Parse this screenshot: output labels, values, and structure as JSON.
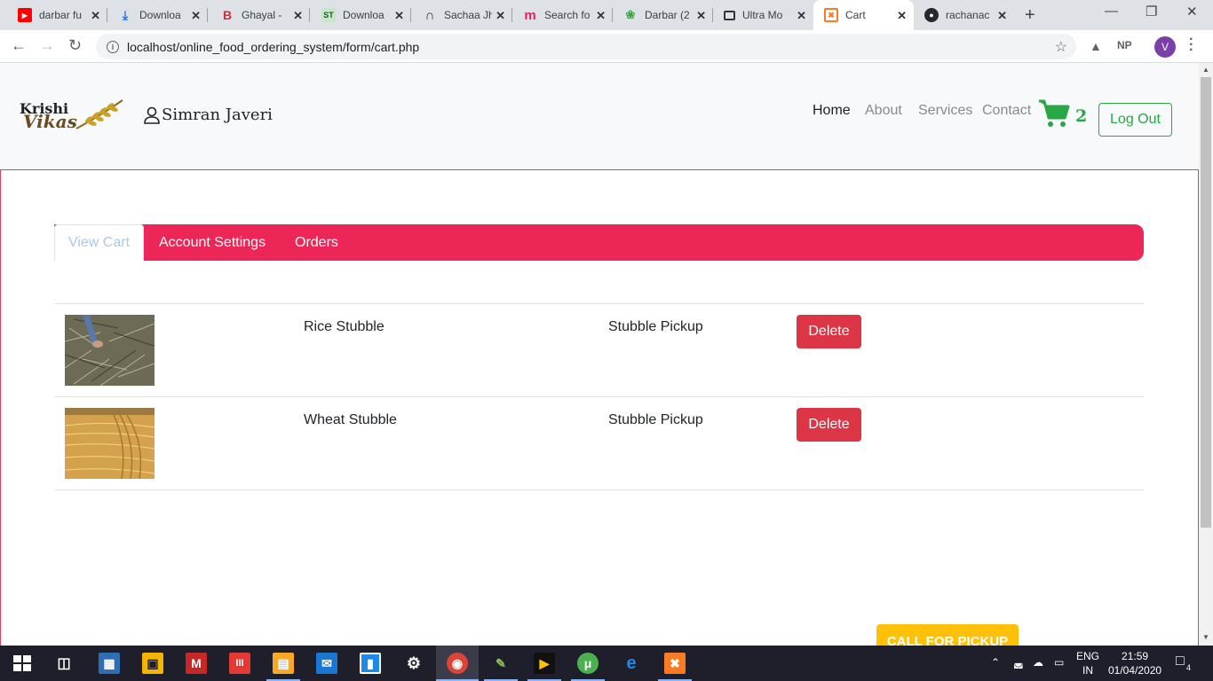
{
  "browser": {
    "tabs": [
      {
        "title": "darbar fu",
        "icon": "youtube-icon",
        "color": "#ff0000"
      },
      {
        "title": "Downloa",
        "icon": "download-icon",
        "color": "#1a73e8"
      },
      {
        "title": "Ghayal - ",
        "icon": "b-logo-icon",
        "color": "#d32f2f"
      },
      {
        "title": "Downloa",
        "icon": "st-logo-icon",
        "color": "#2e7d32"
      },
      {
        "title": "Sachaa Jh",
        "icon": "lyrics-icon",
        "color": "#333333"
      },
      {
        "title": "Search fo",
        "icon": "m-logo-icon",
        "color": "#e91e63"
      },
      {
        "title": "Darbar (2",
        "icon": "leaf-logo-icon",
        "color": "#43a047"
      },
      {
        "title": "Ultra Mo",
        "icon": "briefcase-icon",
        "color": "#333333"
      },
      {
        "title": "Cart",
        "icon": "xampp-icon",
        "color": "#fb7a24"
      },
      {
        "title": "rachanac",
        "icon": "github-icon",
        "color": "#24292e"
      }
    ],
    "url": "localhost/online_food_ordering_system/form/cart.php",
    "profile_initial": "V",
    "ext_label": "NP"
  },
  "site": {
    "logo_top": "Krishi",
    "logo_bottom": "Vikas",
    "username": "Simran Javeri",
    "nav": {
      "home": "Home",
      "about": "About",
      "services": "Services",
      "contact": "Contact"
    },
    "cart_count": "2",
    "logout_label": "Log Out",
    "tabs": {
      "view_cart": "View Cart",
      "account_settings": "Account Settings",
      "orders": "Orders"
    },
    "cart_items": [
      {
        "name": "Rice Stubble",
        "service": "Stubble Pickup",
        "delete_label": "Delete"
      },
      {
        "name": "Wheat Stubble",
        "service": "Stubble Pickup",
        "delete_label": "Delete"
      }
    ],
    "pickup_label": "CALL FOR PICKUP",
    "colors": {
      "accent": "#ec2656",
      "success": "#28a745",
      "danger": "#dc3545",
      "warning": "#ffc107"
    }
  },
  "taskbar": {
    "lang_top": "ENG",
    "lang_bottom": "IN",
    "time": "21:59",
    "date": "01/04/2020",
    "notif_count": "4"
  }
}
